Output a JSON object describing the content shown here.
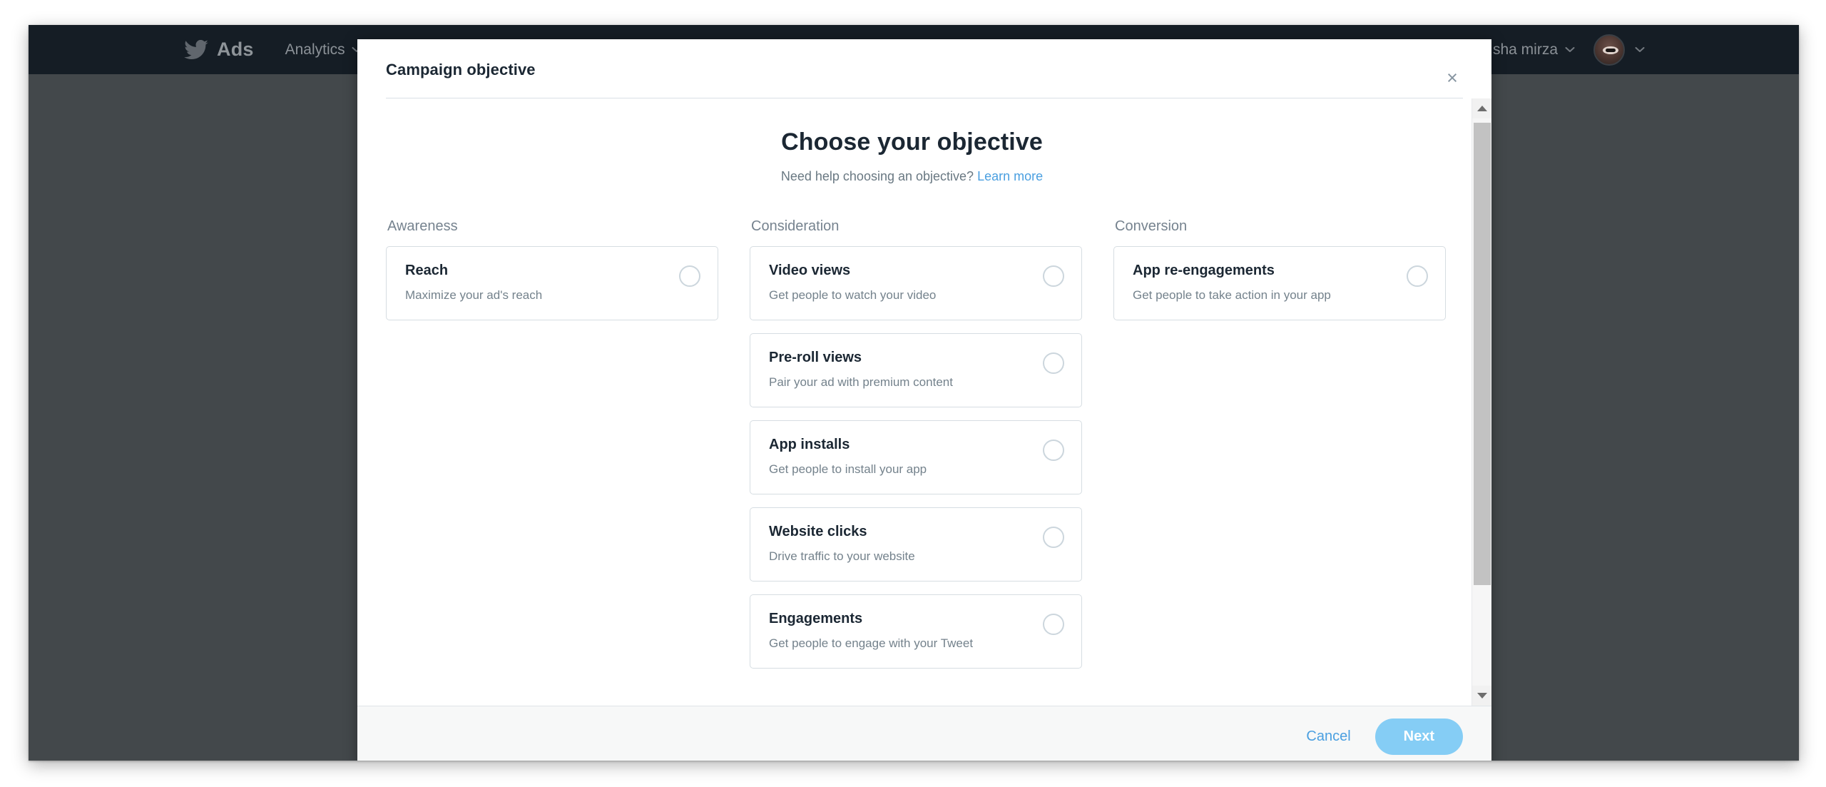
{
  "browser": {
    "nav": {
      "brand_icon": "twitter-bird-icon",
      "brand_label": "Ads",
      "links": [
        {
          "label": "Analytics",
          "icon": "chevron-down-icon"
        }
      ],
      "account_name": "sha mirza",
      "account_caret_icon": "chevron-down-icon",
      "avatar_icon": "user-avatar",
      "avatar_caret_icon": "chevron-down-icon"
    }
  },
  "modal": {
    "title": "Campaign objective",
    "close_icon": "close-icon",
    "close_label": "×",
    "heading": "Choose your objective",
    "subheading_prefix": "Need help choosing an objective?",
    "subheading_link": "Learn more",
    "scrollbar": {
      "up_icon": "scroll-up-arrow-icon",
      "down_icon": "scroll-down-arrow-icon",
      "thumb": "scrollbar-thumb"
    },
    "columns": [
      {
        "title": "Awareness",
        "cards": [
          {
            "title": "Reach",
            "desc": "Maximize your ad's reach",
            "selected": false
          }
        ]
      },
      {
        "title": "Consideration",
        "cards": [
          {
            "title": "Video views",
            "desc": "Get people to watch your video",
            "selected": false
          },
          {
            "title": "Pre-roll views",
            "desc": "Pair your ad with premium content",
            "selected": false
          },
          {
            "title": "App installs",
            "desc": "Get people to install your app",
            "selected": false
          },
          {
            "title": "Website clicks",
            "desc": "Drive traffic to your website",
            "selected": false
          },
          {
            "title": "Engagements",
            "desc": "Get people to engage with your Tweet",
            "selected": false
          }
        ]
      },
      {
        "title": "Conversion",
        "cards": [
          {
            "title": "App re-engagements",
            "desc": "Get people to take action in your app",
            "selected": false
          }
        ]
      }
    ],
    "footer": {
      "cancel_label": "Cancel",
      "next_label": "Next"
    }
  },
  "colors": {
    "nav_bg": "#151d25",
    "page_backdrop": "#43484b",
    "link_blue": "#4a9fe0",
    "next_button_bg": "#85cdf5",
    "card_border": "#d6dde2",
    "heading_text": "#1b2733",
    "muted_text": "#74828c"
  }
}
